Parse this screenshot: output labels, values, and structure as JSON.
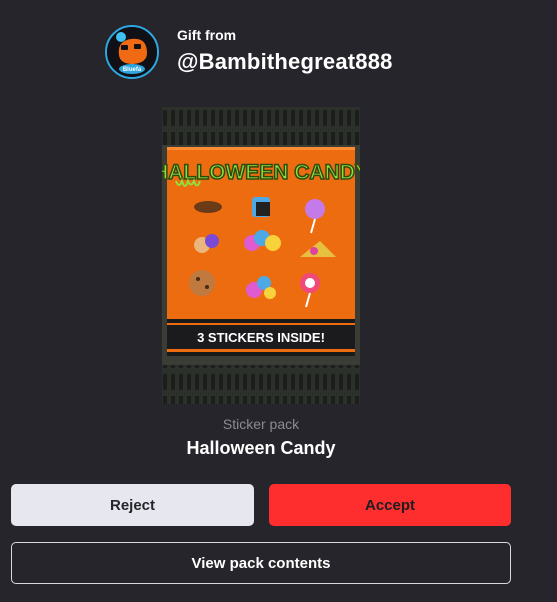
{
  "header": {
    "gift_label": "Gift from",
    "username": "@Bambithegreat888",
    "avatar_text": "Bluefa"
  },
  "pack": {
    "image_title": "HALLOWEEN CANDY",
    "image_banner": "3 STICKERS INSIDE!",
    "type_label": "Sticker pack",
    "name": "Halloween Candy"
  },
  "actions": {
    "reject_label": "Reject",
    "accept_label": "Accept",
    "view_label": "View pack contents"
  },
  "colors": {
    "background": "#25252b",
    "accept": "#ff2e2e",
    "reject": "#e7e7ef",
    "pack_orange": "#ee6c10"
  }
}
